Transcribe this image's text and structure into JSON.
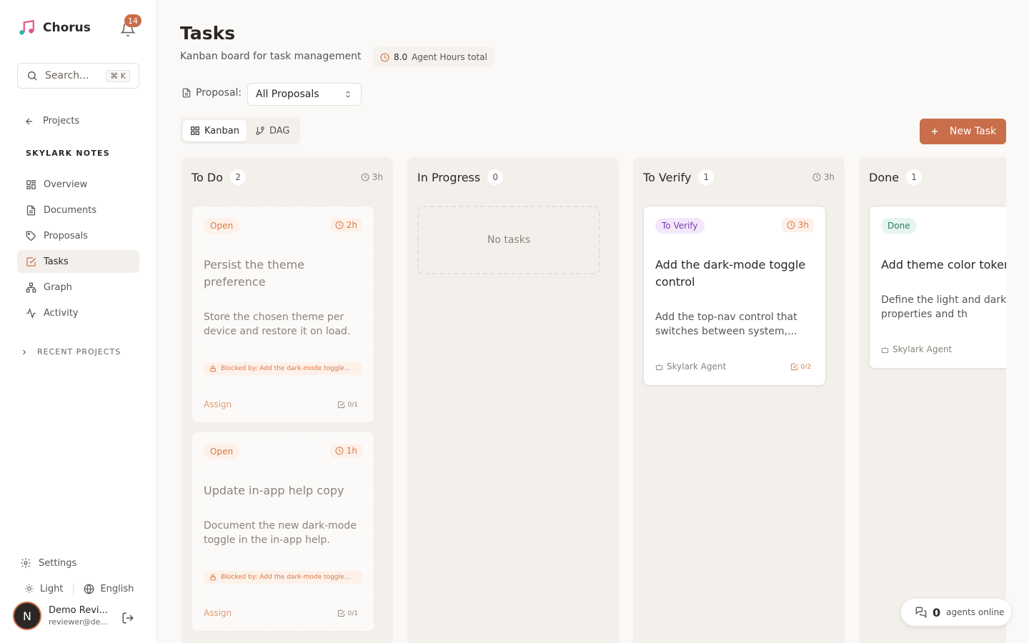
{
  "app": {
    "name": "Chorus",
    "notifications": "14"
  },
  "search": {
    "placeholder": "Search...",
    "shortcut": "⌘ K"
  },
  "sidebar": {
    "back_label": "Projects",
    "project_name": "SKYLARK NOTES",
    "items": [
      {
        "label": "Overview",
        "icon": "grid-icon"
      },
      {
        "label": "Documents",
        "icon": "document-icon"
      },
      {
        "label": "Proposals",
        "icon": "tag-icon"
      },
      {
        "label": "Tasks",
        "icon": "checkbox-icon",
        "active": true
      },
      {
        "label": "Graph",
        "icon": "graph-icon"
      },
      {
        "label": "Activity",
        "icon": "activity-icon"
      }
    ],
    "recent_label": "RECENT PROJECTS",
    "settings_label": "Settings",
    "theme_label": "Light",
    "language_label": "English",
    "user": {
      "initial": "N",
      "name": "Demo Revi...",
      "email": "reviewer@de..."
    }
  },
  "header": {
    "title": "Tasks",
    "subtitle": "Kanban board for task management",
    "hours_value": "8.0",
    "hours_label": "Agent Hours total"
  },
  "filter": {
    "label": "Proposal:",
    "value": "All Proposals"
  },
  "view_toggle": {
    "kanban": "Kanban",
    "dag": "DAG"
  },
  "new_task_label": "New Task",
  "board": {
    "todo": {
      "title": "To Do",
      "count": "2",
      "hours": "3h",
      "cards": [
        {
          "badge": "Open",
          "hours": "2h",
          "title": "Persist the theme preference",
          "desc": "Store the chosen theme per device and restore it on load.",
          "blocked": "Blocked by: Add the dark-mode toggle...",
          "assign": "Assign",
          "subtasks": "0/1"
        },
        {
          "badge": "Open",
          "hours": "1h",
          "title": "Update in-app help copy",
          "desc": "Document the new dark-mode toggle in the in-app help.",
          "blocked": "Blocked by: Add the dark-mode toggle...",
          "assign": "Assign",
          "subtasks": "0/1"
        }
      ]
    },
    "in_progress": {
      "title": "In Progress",
      "count": "0",
      "empty": "No tasks"
    },
    "verify": {
      "title": "To Verify",
      "count": "1",
      "hours": "3h",
      "cards": [
        {
          "badge": "To Verify",
          "hours": "3h",
          "title": "Add the dark-mode toggle control",
          "desc": "Add the top-nav control that switches between system,...",
          "agent": "Skylark Agent",
          "subtasks": "0/2"
        }
      ]
    },
    "done": {
      "title": "Done",
      "count": "1",
      "cards": [
        {
          "badge": "Done",
          "title": "Add theme color tokens",
          "desc": "Define the light and dark custom properties and th",
          "agent": "Skylark Agent"
        }
      ]
    }
  },
  "online": {
    "count": "0",
    "label": "agents online"
  },
  "colors": {
    "accent": "#C96E4A",
    "open": "#D97A45",
    "verify": "#7a3fa8",
    "done": "#2e7d5a"
  }
}
